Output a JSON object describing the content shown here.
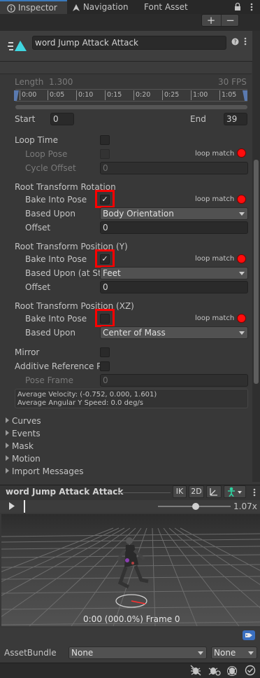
{
  "tabs": [
    {
      "label": "Inspector",
      "icon": "info-icon",
      "active": true
    },
    {
      "label": "Navigation",
      "icon": "navigation-icon",
      "active": false
    },
    {
      "label": "Font Asset Creator",
      "icon": "",
      "active": false
    }
  ],
  "toolbar": {
    "add_label": "+",
    "remove_label": "−"
  },
  "header": {
    "clip_name": "word Jump Attack Attack",
    "icon": "animation-clip-icon"
  },
  "timeline": {
    "length_label": "Length",
    "length_value": "1.300",
    "fps": "30 FPS",
    "ticks": [
      "0:00",
      "0:05",
      "0:10",
      "0:15",
      "0:20",
      "0:25",
      "1:00",
      "1:05"
    ]
  },
  "range": {
    "start_label": "Start",
    "start_value": "0",
    "end_label": "End",
    "end_value": "39"
  },
  "loop": {
    "loop_time_label": "Loop Time",
    "loop_pose_label": "Loop Pose",
    "loop_match": "loop match",
    "cycle_offset_label": "Cycle Offset",
    "cycle_offset_value": "0"
  },
  "root_rotation": {
    "title": "Root Transform Rotation",
    "bake_label": "Bake Into Pose",
    "loop_match": "loop match",
    "based_upon_label": "Based Upon",
    "based_upon_value": "Body Orientation",
    "offset_label": "Offset",
    "offset_value": "0"
  },
  "root_position_y": {
    "title": "Root Transform Position (Y)",
    "bake_label": "Bake Into Pose",
    "loop_match": "loop match",
    "based_upon_label": "Based Upon (at Sta",
    "based_upon_value": "Feet",
    "offset_label": "Offset",
    "offset_value": "0"
  },
  "root_position_xz": {
    "title": "Root Transform Position (XZ)",
    "bake_label": "Bake Into Pose",
    "loop_match": "loop match",
    "based_upon_label": "Based Upon",
    "based_upon_value": "Center of Mass"
  },
  "mirror_label": "Mirror",
  "additive_label": "Additive Reference Po",
  "pose_frame_label": "Pose Frame",
  "pose_frame_value": "0",
  "info": {
    "velocity": "Average Velocity: (-0.752, 0.000, 1.601)",
    "angular": "Average Angular Y Speed: 0.0 deg/s"
  },
  "foldouts": [
    "Curves",
    "Events",
    "Mask",
    "Motion",
    "Import Messages"
  ],
  "preview": {
    "title": "word Jump Attack Attack",
    "ik_label": "IK",
    "mode_label": "2D",
    "speed": "1.07x",
    "frame_label": "0:00 (000.0%) Frame 0"
  },
  "asset_bundle": {
    "label": "AssetBundle",
    "name_value": "None",
    "variant_value": "None"
  },
  "colors": {
    "accent": "#3a79bb",
    "highlight_box": "#ff0000",
    "loop_dot": "#ff0d0d"
  }
}
